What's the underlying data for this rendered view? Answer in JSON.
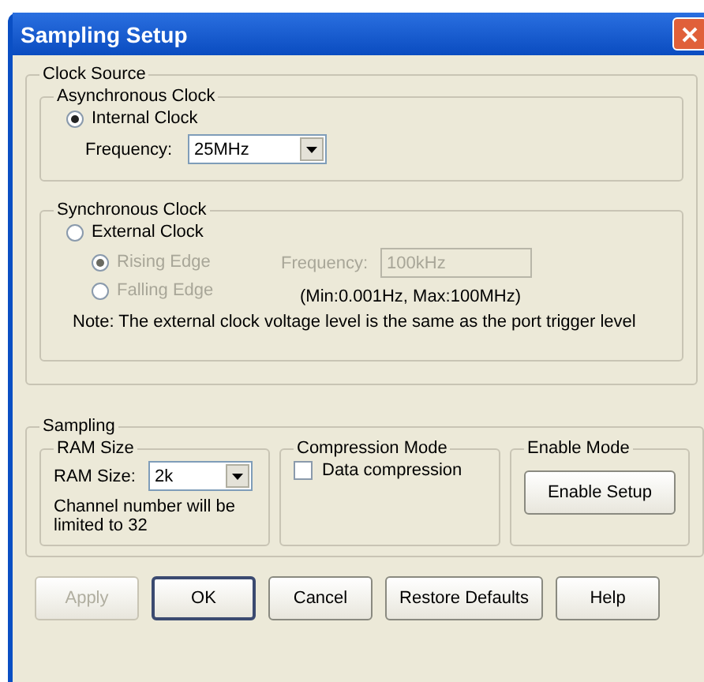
{
  "window": {
    "title": "Sampling Setup"
  },
  "clock_source": {
    "title": "Clock Source",
    "asynchronous": {
      "title": "Asynchronous Clock",
      "option": {
        "label": "Internal Clock",
        "selected": true,
        "disabled": false
      },
      "frequency": {
        "label": "Frequency:",
        "value": "25MHz"
      }
    },
    "synchronous": {
      "title": "Synchronous Clock",
      "option": {
        "label": "External Clock",
        "selected": false,
        "disabled": false
      },
      "edges": [
        {
          "label": "Rising Edge",
          "selected": true,
          "disabled": true
        },
        {
          "label": "Falling Edge",
          "selected": false,
          "disabled": true
        }
      ],
      "frequency": {
        "label": "Frequency:",
        "value": "100kHz",
        "disabled": true
      },
      "range": "(Min:0.001Hz, Max:100MHz)",
      "note": "Note: The external clock voltage level is the same as the port trigger level"
    }
  },
  "sampling": {
    "title": "Sampling",
    "ram": {
      "title": "RAM Size",
      "label": "RAM Size:",
      "value": "2k",
      "hint": "Channel number will be limited to 32"
    },
    "compression": {
      "title": "Compression Mode",
      "checkbox": {
        "label": "Data compression",
        "checked": false
      }
    },
    "enable": {
      "title": "Enable Mode",
      "button": "Enable Setup"
    }
  },
  "buttons": [
    {
      "label": "Apply",
      "disabled": true,
      "default": false
    },
    {
      "label": "OK",
      "disabled": false,
      "default": true
    },
    {
      "label": "Cancel",
      "disabled": false,
      "default": false
    },
    {
      "label": "Restore Defaults",
      "disabled": false,
      "default": false
    },
    {
      "label": "Help",
      "disabled": false,
      "default": false
    }
  ]
}
